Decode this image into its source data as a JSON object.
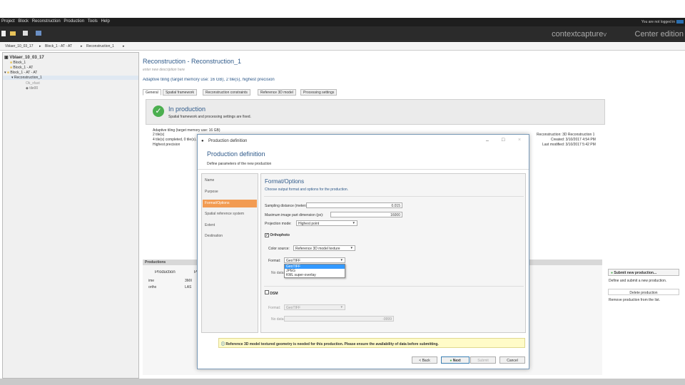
{
  "menu": {
    "items": [
      "Project",
      "Block",
      "Reconstruction",
      "Production",
      "Tools",
      "Help"
    ],
    "right_text": "You are not logged in"
  },
  "brand": {
    "name1": "contextcapture",
    "version": "V",
    "name2": "Center edition"
  },
  "breadcrumb": [
    "Vblaer_10_03_17",
    "Block_1 - AT - AT",
    "Reconstruction_1"
  ],
  "tree": {
    "root": "Vblaer_10_03_17",
    "block1": "Block_1",
    "block2": "Block_1 - AT",
    "block3": "Block_1 - AT - AT",
    "recon": "Reconstruction_1",
    "sub1": "Ok_xfast",
    "sub2": "tile00"
  },
  "header": {
    "title": "Reconstruction - Reconstruction_1",
    "desc": "enter new description here",
    "subtitle": "Adaptive tiling (target memory use: 16 GB), 2 tile(s), highest precision"
  },
  "tabs": [
    "General",
    "Spatial framework",
    "Reconstruction constraints",
    "Reference 3D model",
    "Processing settings"
  ],
  "status": {
    "title": "In production",
    "text": "Spatial framework and processing settings are fixed."
  },
  "info_left": [
    "Adaptive tiling (target memory use: 16 GB)",
    "2 tile(s)",
    "4 tile(s) completed, 0 tile(s)...",
    "Highest precision"
  ],
  "info_right": [
    "Reconstruction: 3D Reconstruction 1",
    "Created: 3/10/2017 4:54 PM",
    "Last modified: 3/10/2017 5:42 PM"
  ],
  "productions": {
    "title": "Productions",
    "col1": "Production",
    "col2": "P",
    "rows": [
      [
        "ime",
        "3MX"
      ],
      [
        "ortho",
        "LAS"
      ]
    ]
  },
  "side_actions": {
    "submit": "Submit new production...",
    "submit_desc": "Define and submit a new production.",
    "delete": "Delete production",
    "delete_desc": "Remove production from the list."
  },
  "dialog": {
    "window_title": "Production definition",
    "heading": "Production definition",
    "subheading": "Define parameters of the new production",
    "steps": [
      "Name",
      "Purpose",
      "Format/Options",
      "Spatial reference system",
      "Extent",
      "Destination"
    ],
    "active_step": 2,
    "content_title": "Format/Options",
    "content_sub": "Choose output format and options for the production.",
    "sampling_label": "Sampling distance (meters):",
    "sampling_value": "0.015",
    "max_image_label": "Maximum image part dimension (px):",
    "max_image_value": "16000",
    "projection_label": "Projection mode:",
    "projection_value": "Highest point",
    "ortho_label": "Orthophoto",
    "color_label": "Color source:",
    "color_value": "Reference 3D model texture",
    "format_label": "Format:",
    "format_value": "GeoTIFF",
    "format_options": [
      "GeoTIFF",
      "JPEG",
      "KML super-overlay"
    ],
    "nodata_label": "No data:",
    "dsm_label": "DSM",
    "dsm_format_label": "Format:",
    "dsm_format_value": "GeoTIFF",
    "dsm_nodata_label": "No data:",
    "dsm_nodata_value": "-9999",
    "notice": "Reference 3D model textured geometry is needed for this production. Please ensure the availability of data before submitting.",
    "back": "< Back",
    "next": "Next",
    "submit": "Submit",
    "cancel": "Cancel"
  }
}
